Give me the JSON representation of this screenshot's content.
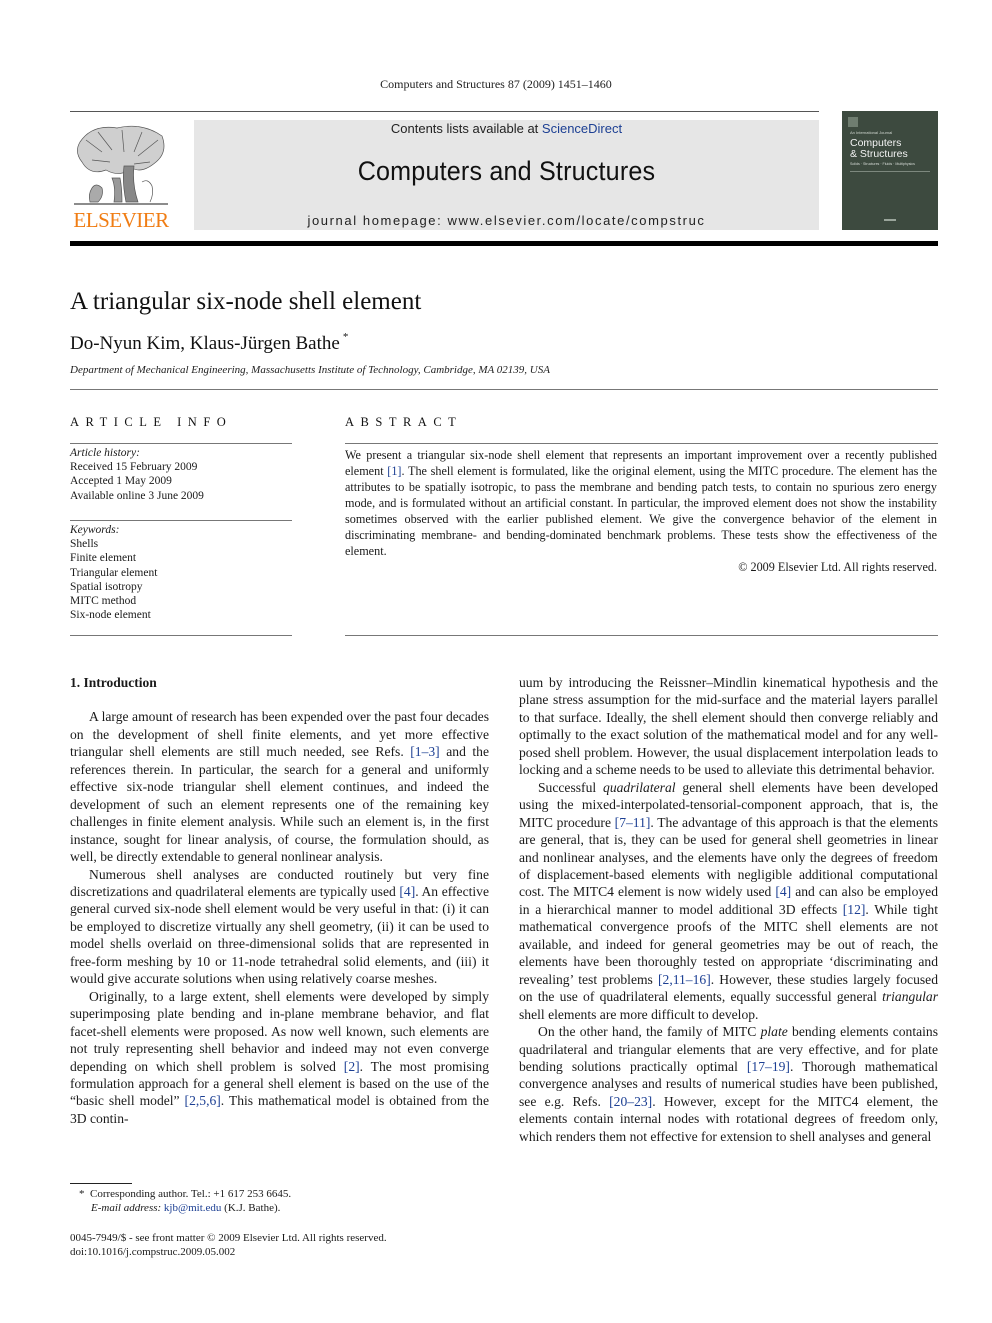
{
  "running_head": "Computers and Structures 87 (2009) 1451–1460",
  "publisher": {
    "logo_icon": "elsevier-tree-logo",
    "name": "ELSEVIER",
    "brand_color": "#f07d14"
  },
  "masthead": {
    "contents_prefix": "Contents lists available at ",
    "contents_link": "ScienceDirect",
    "journal_name": "Computers and Structures",
    "homepage": "journal homepage: www.elsevier.com/locate/compstruc",
    "link_color": "#1c3f93",
    "background": "#e6e6e6"
  },
  "cover": {
    "intl_label": "An International Journal",
    "title_line1": "Computers",
    "title_line2": "& Structures",
    "subtitle": "Solids · Structures · Fluids · Multiphysics",
    "color": "#3d4a3f"
  },
  "article": {
    "title": "A triangular six-node shell element",
    "authors": "Do-Nyun Kim, Klaus-Jürgen Bathe",
    "corresponding_mark": "*",
    "affiliation": "Department of Mechanical Engineering, Massachusetts Institute of Technology, Cambridge, MA 02139, USA"
  },
  "article_info": {
    "heading": "ARTICLE INFO",
    "history_heading": "Article history:",
    "history": [
      "Received 15 February 2009",
      "Accepted 1 May 2009",
      "Available online 3 June 2009"
    ],
    "keywords_heading": "Keywords:",
    "keywords": [
      "Shells",
      "Finite element",
      "Triangular element",
      "Spatial isotropy",
      "MITC method",
      "Six-node element"
    ]
  },
  "abstract": {
    "heading": "ABSTRACT",
    "part1": "We present a triangular six-node shell element that represents an important improvement over a recently published element ",
    "ref1": "[1]",
    "part2": ". The shell element is formulated, like the original element, using the MITC procedure. The element has the attributes to be spatially isotropic, to pass the membrane and bending patch tests, to contain no spurious zero energy mode, and is formulated without an artificial constant. In particular, the improved element does not show the instability sometimes observed with the earlier published element. We give the convergence behavior of the element in discriminating membrane- and bending-dominated benchmark problems. These tests show the effectiveness of the element.",
    "copyright": "© 2009 Elsevier Ltd. All rights reserved."
  },
  "body": {
    "section_heading": "1. Introduction",
    "left": {
      "p1a": "A large amount of research has been expended over the past four decades on the development of shell finite elements, and yet more effective triangular shell elements are still much needed, see Refs. ",
      "p1ref": "[1–3]",
      "p1b": " and the references therein. In particular, the search for a general and uniformly effective six-node triangular shell ele­ment continues, and indeed the development of such an element represents one of the remaining key challenges in finite element analysis. While such an element is, in the first instance, sought for linear analysis, of course, the formulation should, as well, be di­rectly extendable to general nonlinear analysis.",
      "p2a": "Numerous shell analyses are conducted routinely but very fine discretizations and quadrilateral elements are typically used ",
      "p2ref": "[4]",
      "p2b": ". An effective general curved six-node shell element would be very useful in that: (i) it can be employed to discretize virtually any shell geometry, (ii) it can be used to model shells overlaid on three-dimensional solids that are represented in free-form mesh­ing by 10 or 11-node tetrahedral solid elements, and (iii) it would give accurate solutions when using relatively coarse meshes.",
      "p3a": "Originally, to a large extent, shell elements were developed by simply superimposing plate bending and in-plane membrane behavior, and flat facet-shell elements were proposed. As now well known, such elements are not truly representing shell behavior and indeed may not even converge depending on which shell prob­lem is solved ",
      "p3ref1": "[2]",
      "p3b": ". The most promising formulation approach for a general shell element is based on the use of the “basic shell model” ",
      "p3ref2": "[2,5,6]",
      "p3c": ". This mathematical model is obtained from the 3D contin-"
    },
    "right": {
      "p1": "uum by introducing the Reissner–Mindlin kinematical hypothesis and the plane stress assumption for the mid-surface and the mate­rial layers parallel to that surface. Ideally, the shell element should then converge reliably and optimally to the exact solution of the mathematical model and for any well-posed shell problem. How­ever, the usual displacement interpolation leads to locking and a scheme needs to be used to alleviate this detrimental behavior.",
      "p2a": "Successful ",
      "p2em": "quadrilateral",
      "p2b": " general shell elements have been devel­oped using the mixed-interpolated-tensorial-component ap­proach, that is, the MITC procedure ",
      "p2ref1": "[7–11]",
      "p2c": ". The advantage of this approach is that the elements are general, that is, they can be used for general shell geometries in linear and nonlinear analyses, and the elements have only the degrees of freedom of displacement-based elements with negligible additional computational cost. The MITC4 element is now widely used ",
      "p2ref2": "[4]",
      "p2d": " and can also be em­ployed in a hierarchical manner to model additional 3D effects ",
      "p2ref3": "[12]",
      "p2e": ". While tight mathematical convergence proofs of the MITC shell elements are not available, and indeed for general geometries may be out of reach, the elements have been thoroughly tested on appropriate ‘discriminating and revealing’ test problems ",
      "p2ref4": "[2,11–16]",
      "p2f": ". However, these studies largely focused on the use of quadrilateral elements, equally successful general ",
      "p2em2": "triangular",
      "p2g": " shell elements are more difficult to develop.",
      "p3a": "On the other hand, the family of MITC ",
      "p3em": "plate",
      "p3b": " bending elements contains quadrilateral and triangular elements that are very effec­tive, and for plate bending solutions practically optimal ",
      "p3ref1": "[17–19]",
      "p3c": ". Thorough mathematical convergence analyses and results of numerical studies have been published, see e.g. Refs. ",
      "p3ref2": "[20–23]",
      "p3d": ". However, except for the MITC4 element, the elements contain internal nodes with rotational degrees of freedom only, which ren­ders them not effective for extension to shell analyses and general"
    }
  },
  "footnote": {
    "mark": "*",
    "line1": "Corresponding author. Tel.: +1 617 253 6645.",
    "email_label": "E-mail address:",
    "email": "kjb@mit.edu",
    "email_suffix": " (K.J. Bathe)."
  },
  "imprint": {
    "issn_line": "0045-7949/$ - see front matter © 2009 Elsevier Ltd. All rights reserved.",
    "doi": "doi:10.1016/j.compstruc.2009.05.002"
  }
}
